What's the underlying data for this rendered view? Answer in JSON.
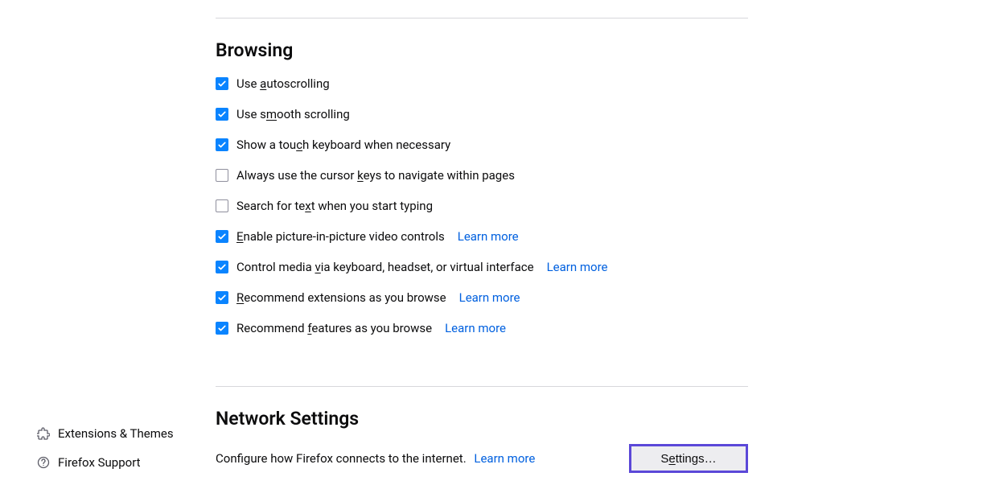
{
  "sidebar": {
    "items": [
      {
        "label": "Extensions & Themes"
      },
      {
        "label": "Firefox Support"
      }
    ]
  },
  "browsing": {
    "title": "Browsing",
    "options": [
      {
        "label_pre": "Use ",
        "accel": "a",
        "label_post": "utoscrolling",
        "checked": true
      },
      {
        "label_pre": "Use s",
        "accel": "m",
        "label_post": "ooth scrolling",
        "checked": true
      },
      {
        "label_pre": "Show a tou",
        "accel": "c",
        "label_post": "h keyboard when necessary",
        "checked": true
      },
      {
        "label_pre": "Always use the cursor ",
        "accel": "k",
        "label_post": "eys to navigate within pages",
        "checked": false
      },
      {
        "label_pre": "Search for te",
        "accel": "x",
        "label_post": "t when you start typing",
        "checked": false
      },
      {
        "label_pre": "",
        "accel": "E",
        "label_post": "nable picture-in-picture video controls",
        "checked": true,
        "learn": "Learn more"
      },
      {
        "label_pre": "Control media ",
        "accel": "v",
        "label_post": "ia keyboard, headset, or virtual interface",
        "checked": true,
        "learn": "Learn more"
      },
      {
        "label_pre": "",
        "accel": "R",
        "label_post": "ecommend extensions as you browse",
        "checked": true,
        "learn": "Learn more"
      },
      {
        "label_pre": "Recommend ",
        "accel": "f",
        "label_post": "eatures as you browse",
        "checked": true,
        "learn": "Learn more"
      }
    ]
  },
  "network": {
    "title": "Network Settings",
    "desc": "Configure how Firefox connects to the internet.",
    "learn": "Learn more",
    "button_pre": "S",
    "button_accel": "e",
    "button_post": "ttings…"
  }
}
